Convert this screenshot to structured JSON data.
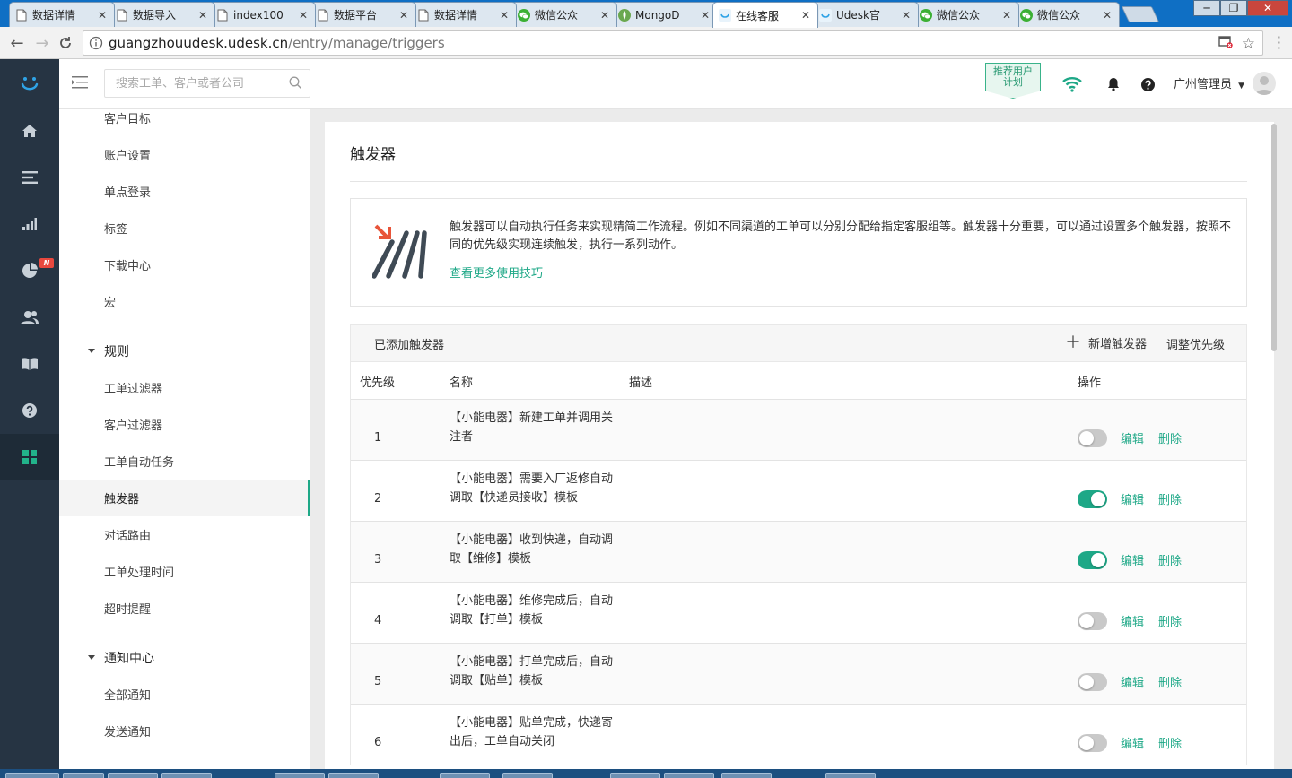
{
  "browser": {
    "tabs": [
      {
        "title": "数据详情",
        "icon": "doc",
        "active": false
      },
      {
        "title": "数据导入",
        "icon": "doc",
        "active": false
      },
      {
        "title": "index100",
        "icon": "doc",
        "active": false
      },
      {
        "title": "数据平台",
        "icon": "doc",
        "active": false
      },
      {
        "title": "数据详情",
        "icon": "doc",
        "active": false
      },
      {
        "title": "微信公众",
        "icon": "wechat",
        "active": false
      },
      {
        "title": "MongoD",
        "icon": "mongo",
        "active": false
      },
      {
        "title": "在线客服",
        "icon": "udesk",
        "active": true
      },
      {
        "title": "Udesk官",
        "icon": "udesk",
        "active": false
      },
      {
        "title": "微信公众",
        "icon": "wechat",
        "active": false
      },
      {
        "title": "微信公众",
        "icon": "wechat",
        "active": false
      }
    ],
    "url_host": "guangzhouudesk.udesk.cn",
    "url_path": "/entry/manage/triggers"
  },
  "header": {
    "search_placeholder": "搜索工单、客户或者公司",
    "promo_line1": "推荐用户",
    "promo_line2": "计划",
    "user_name": "广州管理员"
  },
  "submenu": {
    "items": [
      {
        "type": "item",
        "label": "客户目标",
        "active": false
      },
      {
        "type": "item",
        "label": "账户设置",
        "active": false
      },
      {
        "type": "item",
        "label": "单点登录",
        "active": false
      },
      {
        "type": "item",
        "label": "标签",
        "active": false
      },
      {
        "type": "item",
        "label": "下载中心",
        "active": false
      },
      {
        "type": "item",
        "label": "宏",
        "active": false
      },
      {
        "type": "group",
        "label": "规则"
      },
      {
        "type": "item",
        "label": "工单过滤器",
        "active": false
      },
      {
        "type": "item",
        "label": "客户过滤器",
        "active": false
      },
      {
        "type": "item",
        "label": "工单自动任务",
        "active": false
      },
      {
        "type": "item",
        "label": "触发器",
        "active": true
      },
      {
        "type": "item",
        "label": "对话路由",
        "active": false
      },
      {
        "type": "item",
        "label": "工单处理时间",
        "active": false
      },
      {
        "type": "item",
        "label": "超时提醒",
        "active": false
      },
      {
        "type": "group",
        "label": "通知中心"
      },
      {
        "type": "item",
        "label": "全部通知",
        "active": false
      },
      {
        "type": "item",
        "label": "发送通知",
        "active": false
      }
    ]
  },
  "main": {
    "title": "触发器",
    "info_text": "触发器可以自动执行任务来实现精简工作流程。例如不同渠道的工单可以分别分配给指定客服组等。触发器十分重要，可以通过设置多个触发器，按照不同的优先级实现连续触发，执行一系列动作。",
    "info_link": "查看更多使用技巧",
    "list_title": "已添加触发器",
    "add_label": "新增触发器",
    "priority_label": "调整优先级",
    "columns": {
      "priority": "优先级",
      "name": "名称",
      "desc": "描述",
      "action": "操作"
    },
    "edit_label": "编辑",
    "delete_label": "删除",
    "rows": [
      {
        "priority": "1",
        "name": "【小能电器】新建工单并调用关注者",
        "enabled": false
      },
      {
        "priority": "2",
        "name": "【小能电器】需要入厂返修自动调取【快递员接收】模板",
        "enabled": true
      },
      {
        "priority": "3",
        "name": "【小能电器】收到快递，自动调取【维修】模板",
        "enabled": true
      },
      {
        "priority": "4",
        "name": "【小能电器】维修完成后，自动调取【打单】模板",
        "enabled": false
      },
      {
        "priority": "5",
        "name": "【小能电器】打单完成后，自动调取【贴单】模板",
        "enabled": false
      },
      {
        "priority": "6",
        "name": "【小能电器】贴单完成，快递寄出后，工单自动关闭",
        "enabled": false
      }
    ]
  },
  "colors": {
    "accent": "#1ea887",
    "sidebar": "#263443",
    "badge": "#e8483e"
  }
}
